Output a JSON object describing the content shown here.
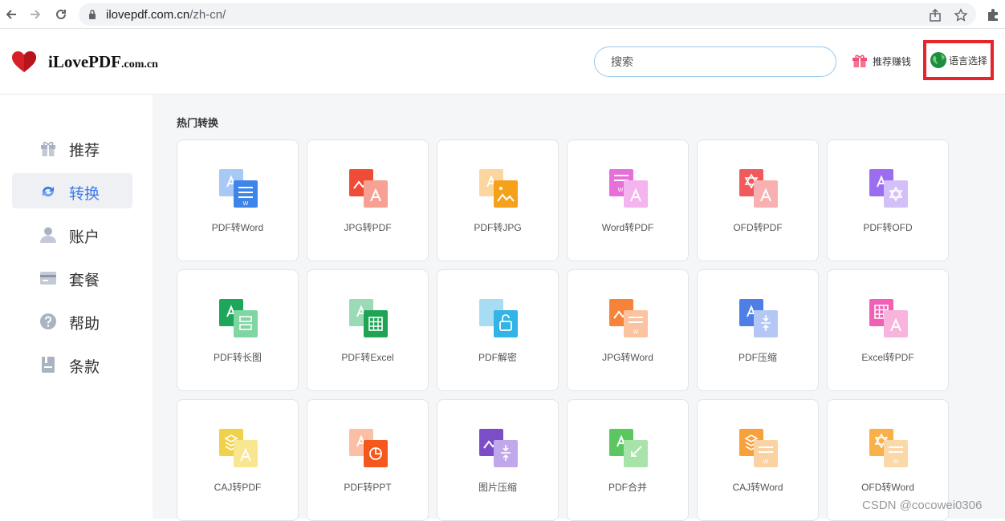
{
  "browser": {
    "url_host": "ilovepdf.com.cn",
    "url_path": "/zh-cn/"
  },
  "header": {
    "logo_main": "iLovePDF",
    "logo_domain": ".com.cn",
    "search_placeholder": "搜索",
    "referral_label": "推荐赚钱",
    "language_label": "语言选择"
  },
  "sidebar": {
    "items": [
      {
        "label": "推荐",
        "icon": "gift-icon"
      },
      {
        "label": "转换",
        "icon": "convert-icon"
      },
      {
        "label": "账户",
        "icon": "user-icon"
      },
      {
        "label": "套餐",
        "icon": "card-icon"
      },
      {
        "label": "帮助",
        "icon": "help-icon"
      },
      {
        "label": "条款",
        "icon": "terms-icon"
      }
    ],
    "active_index": 1
  },
  "main": {
    "section_title": "热门转换",
    "tools": [
      {
        "label": "PDF转Word"
      },
      {
        "label": "JPG转PDF"
      },
      {
        "label": "PDF转JPG"
      },
      {
        "label": "Word转PDF"
      },
      {
        "label": "OFD转PDF"
      },
      {
        "label": "PDF转OFD"
      },
      {
        "label": "PDF转长图"
      },
      {
        "label": "PDF转Excel"
      },
      {
        "label": "PDF解密"
      },
      {
        "label": "JPG转Word"
      },
      {
        "label": "PDF压缩"
      },
      {
        "label": "Excel转PDF"
      },
      {
        "label": "CAJ转PDF"
      },
      {
        "label": "PDF转PPT"
      },
      {
        "label": "图片压缩"
      },
      {
        "label": "PDF合并"
      },
      {
        "label": "CAJ转Word"
      },
      {
        "label": "OFD转Word"
      }
    ]
  },
  "watermark": "CSDN @cocowei0306",
  "colors": {
    "accent": "#3b7ae6",
    "highlight_box": "#e8242b",
    "logo_red": "#d62027"
  }
}
